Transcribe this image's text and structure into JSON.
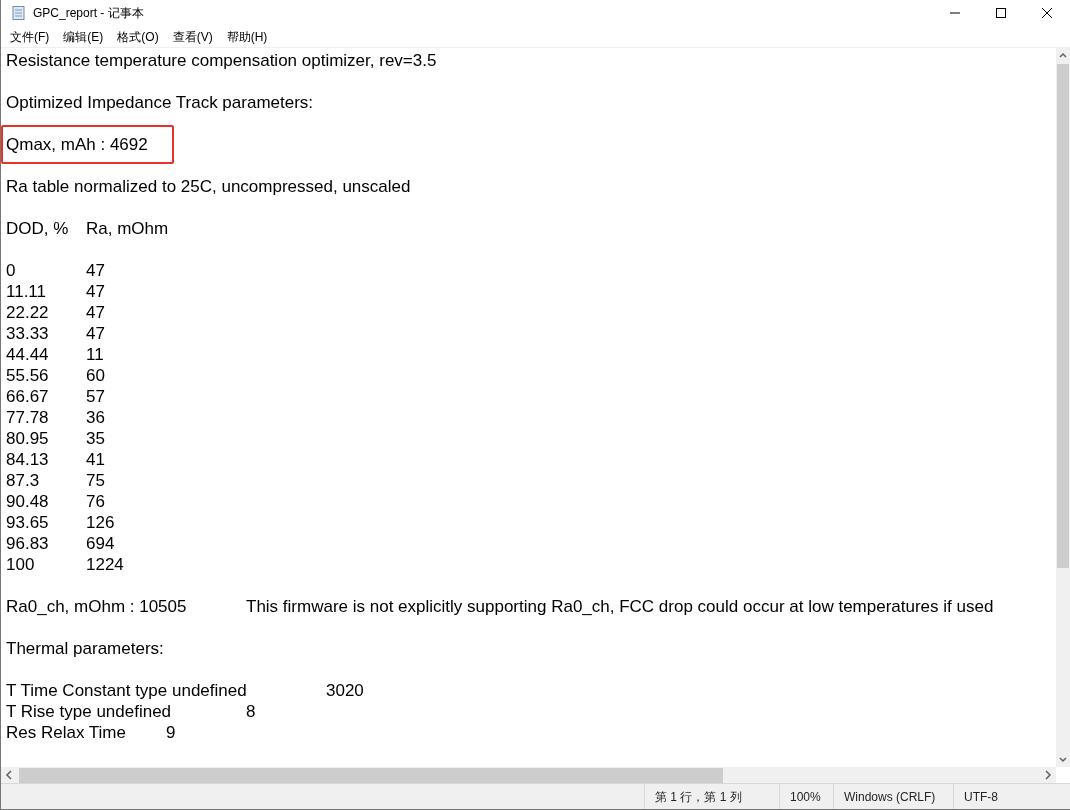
{
  "window": {
    "title": "GPC_report - 记事本"
  },
  "menu": [
    "文件(F)",
    "编辑(E)",
    "格式(O)",
    "查看(V)",
    "帮助(H)"
  ],
  "paragraphs": [
    {
      "lines": [
        {
          "cells": [
            "Resistance temperature compensation optimizer, rev=3.5"
          ]
        }
      ]
    },
    {
      "lines": [
        {
          "cells": [
            "Optimized Impedance Track parameters:"
          ]
        }
      ]
    },
    {
      "lines": [
        {
          "cells": [
            "Qmax, mAh : 4692"
          ],
          "highlighted": true
        }
      ]
    },
    {
      "lines": [
        {
          "cells": [
            "Ra table normalized to 25C, uncompressed, unscaled"
          ]
        }
      ]
    },
    {
      "lines": [
        {
          "cells": [
            "DOD, %",
            "Ra, mOhm"
          ]
        }
      ]
    },
    {
      "lines": [
        {
          "cells": [
            "0",
            "47"
          ]
        },
        {
          "cells": [
            "11.11",
            "47"
          ]
        },
        {
          "cells": [
            "22.22",
            "47"
          ]
        },
        {
          "cells": [
            "33.33",
            "47"
          ]
        },
        {
          "cells": [
            "44.44",
            "11"
          ]
        },
        {
          "cells": [
            "55.56",
            "60"
          ]
        },
        {
          "cells": [
            "66.67",
            "57"
          ]
        },
        {
          "cells": [
            "77.78",
            "36"
          ]
        },
        {
          "cells": [
            "80.95",
            "35"
          ]
        },
        {
          "cells": [
            "84.13",
            "41"
          ]
        },
        {
          "cells": [
            "87.3",
            "75"
          ]
        },
        {
          "cells": [
            "90.48",
            "76"
          ]
        },
        {
          "cells": [
            "93.65",
            "126"
          ]
        },
        {
          "cells": [
            "96.83",
            "694"
          ]
        },
        {
          "cells": [
            "100",
            "1224"
          ]
        }
      ]
    },
    {
      "lines": [
        {
          "cells": [
            "Ra0_ch, mOhm : 10505",
            "This firmware is not explicitly supporting Ra0_ch, FCC drop could occur at low temperatures if used"
          ]
        }
      ]
    },
    {
      "lines": [
        {
          "cells": [
            "Thermal parameters:"
          ]
        }
      ]
    },
    {
      "lines": [
        {
          "cells": [
            "T Time Constant type undefined",
            "3020"
          ]
        },
        {
          "cells": [
            "T Rise type undefined",
            "8"
          ]
        },
        {
          "cells": [
            "Res Relax Time",
            "9"
          ]
        }
      ]
    }
  ],
  "status_bar": [
    "第 1 行，第 1 列",
    "100%",
    "Windows (CRLF)",
    "UTF-8"
  ]
}
